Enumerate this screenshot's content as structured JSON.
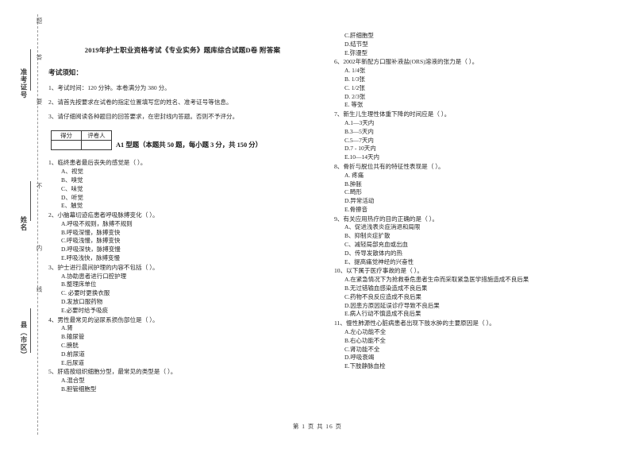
{
  "document": {
    "title": "2019年护士职业资格考试《专业实务》题库综合试题D卷 附答案",
    "footer": "第 1 页 共 16 页"
  },
  "seal_margin": {
    "fields": [
      {
        "label": "准考证号",
        "top_word": "题",
        "bottom_word": "答"
      },
      {
        "label": "姓名",
        "top_word": "要",
        "bottom_word": "不"
      },
      {
        "label": "县（市区）",
        "top_word": "内",
        "bottom_word": "线"
      }
    ],
    "edge_words": [
      "题",
      "答",
      "要",
      "不",
      "内",
      "线"
    ]
  },
  "notice": {
    "heading": "考试须知：",
    "items": [
      "1、考试时间：120 分钟。本卷满分为 380 分。",
      "2、请首先按要求在试卷的指定位置填写您的姓名、准考证号等信息。",
      "3、请仔细阅读各种题目的回答要求，在密封线内答题。否则不予评分。"
    ]
  },
  "score_table": {
    "headers": [
      "得分",
      "评卷人"
    ],
    "values": [
      "",
      ""
    ]
  },
  "section": {
    "title": "A1 型题（本题共 50 题，每小题 3 分，共 150 分）"
  },
  "questions_left": [
    {
      "stem": "1、临终患者最后丧失的感觉是（      ）。",
      "options": [
        "A、视觉",
        "B、嗅觉",
        "C、味觉",
        "D、听觉",
        "E、触觉"
      ]
    },
    {
      "stem": "2、小脑幕切迹疝患者呼吸脉搏变化（      ）。",
      "options": [
        "A.呼吸不规则，脉搏不规则",
        "B.呼吸深慢，脉搏变快",
        "C.呼吸浅慢，脉搏变快",
        "D.呼吸深快，脉搏变慢",
        "E.呼吸浅快，脉搏变慢"
      ]
    },
    {
      "stem": "3、护士进行晨间护理的内容不包括（      ）。",
      "options": [
        "A.协助患者进行口腔护理",
        "B.整理床单位",
        "C. 必要时更换衣服",
        "D.发放口服药物",
        "E.必要时给予吸痰"
      ]
    },
    {
      "stem": "4、男性最常见的泌尿系损伤部位是（      ）。",
      "options": [
        "A.肾",
        "B.输尿管",
        "C.膀胱",
        "D.前尿道",
        "E.后尿道"
      ]
    },
    {
      "stem": "5、肝癌按组织细胞分型，最常见的类型是（      ）。",
      "options": [
        "A.混合型",
        "B.胆管细胞型"
      ]
    }
  ],
  "questions_right": [
    {
      "stem": "",
      "options": [
        "C.肝细胞型",
        "D.结节型",
        "E.弥漫型"
      ]
    },
    {
      "stem": "6、2002年新配方口服补液盐(ORS)溶液的张力是（      ）。",
      "options": [
        "A. 1/4张",
        "B. 1/3张",
        "C. 1/2张",
        "D. 2/3张",
        "E. 等张"
      ]
    },
    {
      "stem": "7、新生儿生理性体重下降的时间应是（      ）。",
      "options": [
        "A.1—3天内",
        "B.3—5天内",
        "C.5—7天内",
        "D.7 - 10天内",
        "E.10—14天内"
      ]
    },
    {
      "stem": "8、骨折与脱位共有的特征性表现是（      ）。",
      "options": [
        "A. 疼痛",
        "B.肿胀",
        "C.畸形",
        "D.异常活动",
        "E.骨擦音"
      ]
    },
    {
      "stem": "9、有关应用热疗的目的正确的是（      ）。",
      "options": [
        "A、促进浅表炎症消退和局限",
        "B、抑制炎症扩散",
        "C、减轻局部充血或出血",
        "D、传导发散体内的热",
        "E、提高痛觉神经的兴奋性"
      ]
    },
    {
      "stem": "10、以下属于医疗事故的是（      ）。",
      "options": [
        "A.在紧急情况下为抢救垂危患者生命而采取紧急医学措施造成不良后果",
        "B.无过错输血感染造成不良后果",
        "C.药物不良反应造成不良后果",
        "D.因患方原因延误诊疗导致不良后果",
        "E.病人行动不慎造成不良后果"
      ]
    },
    {
      "stem": "11、慢性肺源性心脏病患者出现下肢水肿的主要原因是（      ）。",
      "options": [
        "A.左心功能不全",
        "B.右心功能不全",
        "C.肾功能不全",
        "D.呼吸衰竭",
        "E.下肢静脉血栓"
      ]
    }
  ]
}
